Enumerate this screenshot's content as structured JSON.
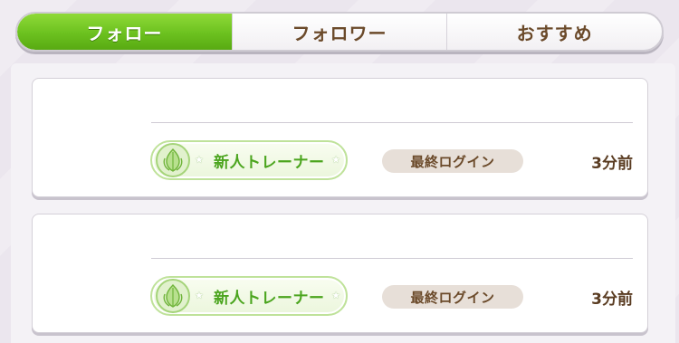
{
  "tabs": [
    {
      "label": "フォロー",
      "active": true
    },
    {
      "label": "フォロワー",
      "active": false
    },
    {
      "label": "おすすめ",
      "active": false
    }
  ],
  "cards": [
    {
      "rank": "新人トレーナー",
      "login_label": "最終ログイン",
      "login_time": "3分前"
    },
    {
      "rank": "新人トレーナー",
      "login_label": "最終ログイン",
      "login_time": "3分前"
    }
  ],
  "colors": {
    "active_tab": "#6cc11f",
    "text_brown": "#6b4a2a",
    "rank_green": "#4ba51e",
    "login_pill_bg": "#e7dfd8"
  },
  "icons": {
    "rank_emblem": "leaf-crest-icon",
    "rank_star": "star-icon"
  }
}
